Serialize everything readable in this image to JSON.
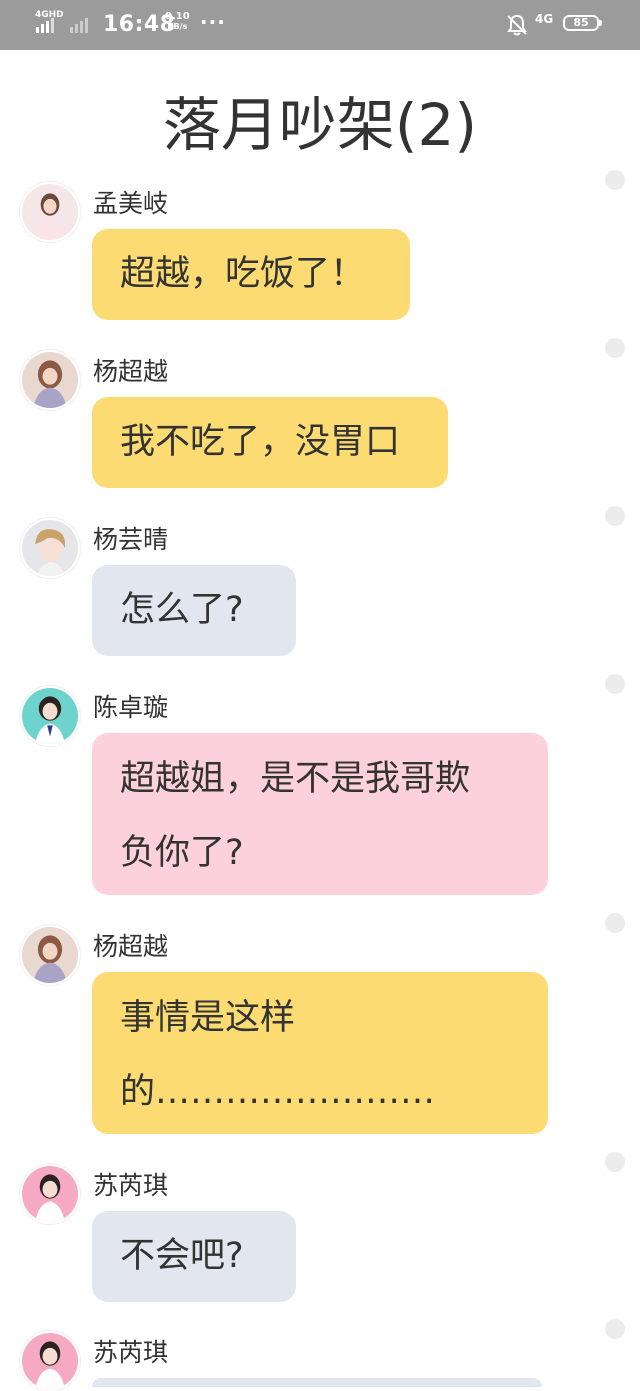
{
  "status_bar": {
    "network_left": "4GHD",
    "time": "16:48",
    "speed_value": "0.10",
    "speed_unit": "KB/s",
    "more": "···",
    "network_right": "4G",
    "battery": "85",
    "icons": [
      "signal-icon",
      "bell-muted-icon",
      "battery-icon"
    ]
  },
  "title": "落月吵架(2)",
  "messages": [
    {
      "name": "孟美岐",
      "lines": [
        "超越，吃饭了！"
      ],
      "bubble_color": "#fcdc72",
      "avatar_bg": "#f5e6e8"
    },
    {
      "name": "杨超越",
      "lines": [
        "我不吃了，没胃口"
      ],
      "bubble_color": "#fcdc72",
      "avatar_bg": "#e8d8cf"
    },
    {
      "name": "杨芸晴",
      "lines": [
        "怎么了?"
      ],
      "bubble_color": "#e2e6ee",
      "avatar_bg": "#e6e6ea"
    },
    {
      "name": "陈卓璇",
      "lines": [
        "超越姐，是不是我哥欺",
        "负你了?"
      ],
      "bubble_color": "#fdd1db",
      "avatar_bg": "#6fd3cd"
    },
    {
      "name": "杨超越",
      "lines": [
        "事情是这样",
        "的……………………"
      ],
      "bubble_color": "#fcdc72",
      "avatar_bg": "#e8d8cf"
    },
    {
      "name": "苏芮琪",
      "lines": [
        "不会吧?"
      ],
      "bubble_color": "#e2e6ee",
      "avatar_bg": "#f5a9c2"
    },
    {
      "name": "苏芮琪",
      "lines": [],
      "bubble_color": "#e2e6ee",
      "avatar_bg": "#f5a9c2"
    }
  ]
}
